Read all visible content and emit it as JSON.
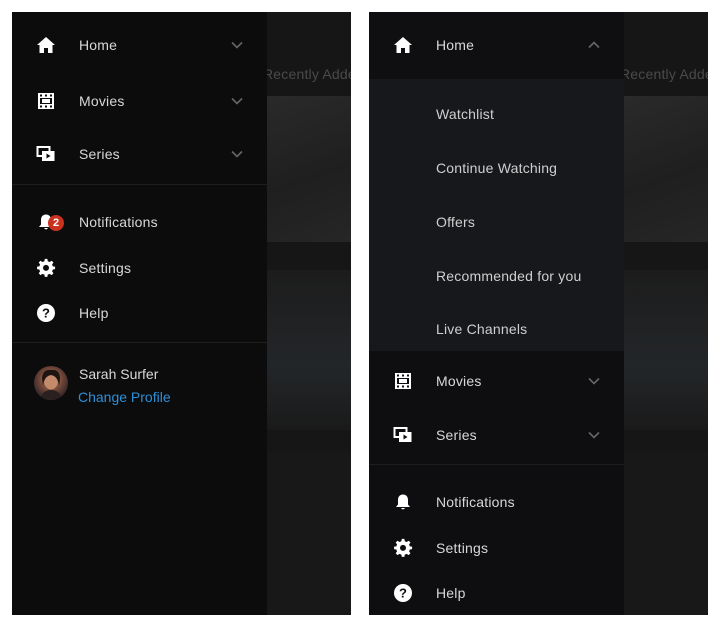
{
  "left_screen": {
    "background_title": "Recently Added",
    "nav": [
      {
        "label": "Home",
        "icon": "home-icon"
      },
      {
        "label": "Movies",
        "icon": "film-icon"
      },
      {
        "label": "Series",
        "icon": "series-icon"
      }
    ],
    "notifications": {
      "label": "Notifications",
      "badge": "2",
      "icon": "bell-icon"
    },
    "settings": {
      "label": "Settings",
      "icon": "gear-icon"
    },
    "help": {
      "label": "Help",
      "icon": "help-icon"
    },
    "profile": {
      "name": "Sarah Surfer",
      "change_label": "Change Profile"
    }
  },
  "right_screen": {
    "background_title": "Recently Added",
    "home": {
      "label": "Home",
      "expanded": true
    },
    "submenu": [
      "Watchlist",
      "Continue Watching",
      "Offers",
      "Recommended for you",
      "Live Channels"
    ],
    "nav": [
      {
        "label": "Movies"
      },
      {
        "label": "Series"
      }
    ],
    "notifications": {
      "label": "Notifications"
    },
    "settings": {
      "label": "Settings"
    },
    "help": {
      "label": "Help"
    }
  },
  "colors": {
    "drawer_bg": "#0c0c0d",
    "submenu_bg": "#17181b",
    "text": "#d8d8d8",
    "link": "#2f8fd6",
    "badge": "#c8321f"
  }
}
